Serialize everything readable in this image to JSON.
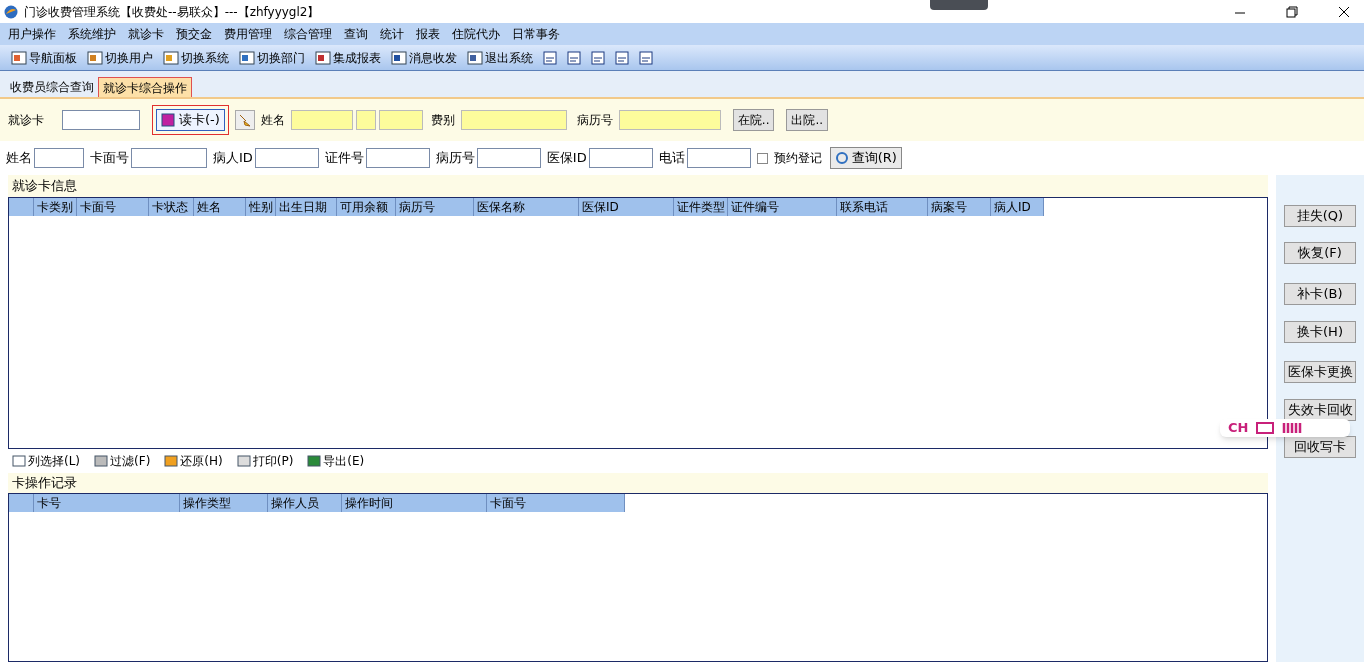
{
  "window": {
    "title": "门诊收费管理系统【收费处--易联众】---【zhfyyygl2】"
  },
  "menu": [
    "用户操作",
    "系统维护",
    "就诊卡",
    "预交金",
    "费用管理",
    "综合管理",
    "查询",
    "统计",
    "报表",
    "住院代办",
    "日常事务"
  ],
  "toolbar": [
    {
      "label": "导航面板"
    },
    {
      "label": "切换用户"
    },
    {
      "label": "切换系统"
    },
    {
      "label": "切换部门"
    },
    {
      "label": "集成报表"
    },
    {
      "label": "消息收发"
    },
    {
      "label": "退出系统"
    }
  ],
  "tabs": [
    {
      "label": "收费员综合查询",
      "selected": false
    },
    {
      "label": "就诊卡综合操作",
      "selected": true
    }
  ],
  "card_row": {
    "card_label": "就诊卡",
    "read_button": "读卡(-)",
    "name_label": "姓名",
    "fee_label": "费别",
    "record_label": "病历号",
    "buttons": [
      "在院..",
      "出院.."
    ]
  },
  "search_row": {
    "fields": [
      "姓名",
      "卡面号",
      "病人ID",
      "证件号",
      "病历号",
      "医保ID",
      "电话"
    ],
    "reserve": {
      "label": "预约登记",
      "checked": false
    },
    "query_button": "查询(R)"
  },
  "card_info": {
    "title": "就诊卡信息",
    "columns": [
      "卡类别",
      "卡面号",
      "卡状态",
      "姓名",
      "性别",
      "出生日期",
      "可用余额",
      "病历号",
      "医保名称",
      "医保ID",
      "证件类型",
      "证件编号",
      "联系电话",
      "病案号",
      "病人ID"
    ]
  },
  "grid_tools": [
    "列选择(L)",
    "过滤(F)",
    "还原(H)",
    "打印(P)",
    "导出(E)"
  ],
  "operation_log": {
    "title": "卡操作记录",
    "columns": [
      "卡号",
      "操作类型",
      "操作人员",
      "操作时间",
      "卡面号"
    ]
  },
  "side_buttons": [
    "挂失(Q)",
    "恢复(F)",
    "补卡(B)",
    "换卡(H)",
    "医保卡更换",
    "失效卡回收",
    "回收写卡"
  ],
  "ime_bar": {
    "label": "CH"
  }
}
